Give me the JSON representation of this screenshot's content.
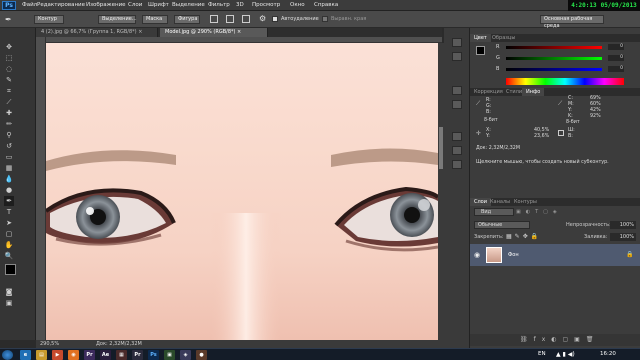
{
  "clock": {
    "time": "4:20:13",
    "date": "05/09/2013"
  },
  "menu": {
    "items": [
      "Файл",
      "Редактирование",
      "Изображение",
      "Слои",
      "Шрифт",
      "Выделение",
      "Фильтр",
      "3D",
      "Просмотр",
      "Окно",
      "Справка"
    ]
  },
  "options": {
    "mode_select": "Контур",
    "b1": "Выделение...",
    "b2": "Маска",
    "b3": "Фигура",
    "build": "Сделать",
    "auto_add": "Автоудаление",
    "align_edges": "Выравн. края",
    "workspace": "Основная рабочая среда"
  },
  "tabs": [
    {
      "label": "4 (2).jpg @ 66,7% (Группа 1, RGB/8*) ×"
    },
    {
      "label": "Model.jpg @ 290% (RGB/8*) ×"
    }
  ],
  "status": {
    "zoom": "290,5%",
    "doc": "Док: 2,32M/2,32M"
  },
  "color_panel": {
    "tabs": [
      "Цвет",
      "Образцы"
    ],
    "r": {
      "label": "R",
      "value": "0"
    },
    "g": {
      "label": "G",
      "value": "0"
    },
    "b": {
      "label": "B",
      "value": "0"
    }
  },
  "info_panel": {
    "tabs": [
      "Коррекция",
      "Стили",
      "Инфо"
    ],
    "rgb": [
      "R:",
      "G:",
      "B:"
    ],
    "bit1": "8-бит",
    "cmyk": [
      "C:",
      "M:",
      "Y:",
      "K:"
    ],
    "cmyk_vals": [
      "69%",
      "60%",
      "42%",
      "92%"
    ],
    "bit2": "8-бит",
    "x_label": "X:",
    "y_label": "Y:",
    "w_label": "Ш:",
    "h_label": "В:",
    "xy_vals": [
      "40,5%",
      "23,6%"
    ],
    "doc": "Док: 2,32M/2,32M",
    "hint": "Щелкните мышью, чтобы создать новый субконтур."
  },
  "layers_panel": {
    "tabs": [
      "Слои",
      "Каналы",
      "Контуры"
    ],
    "kind": "Вид",
    "blend": "Обычные",
    "opacity_label": "Непрозрачность:",
    "opacity": "100%",
    "lock_label": "Закрепить:",
    "fill_label": "Заливка:",
    "fill": "100%",
    "layer_name": "Фон"
  },
  "taskbar": {
    "lang": "EN",
    "time": "16:20"
  }
}
